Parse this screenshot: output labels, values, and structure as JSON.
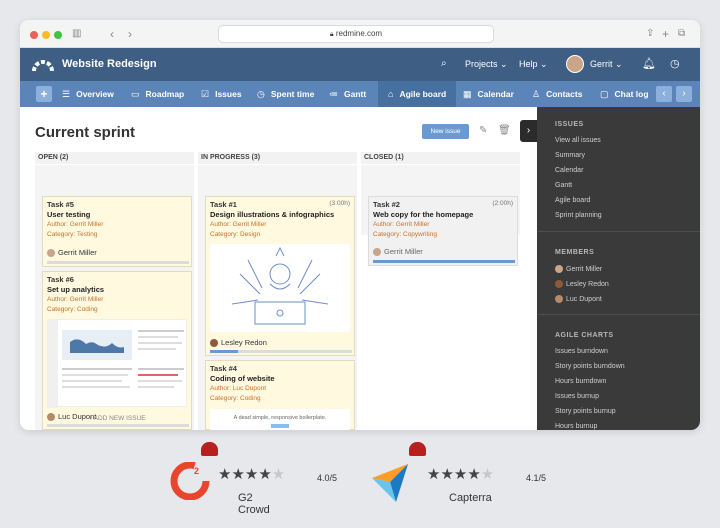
{
  "browser": {
    "url": "redmine.com",
    "icons": {
      "back": "chevron-left-icon",
      "forward": "chevron-right-icon",
      "sidebar": "sidebar-icon",
      "lock": "lock-icon",
      "share": "share-icon",
      "new_tab": "plus-icon",
      "tabs": "tabs-icon"
    }
  },
  "header": {
    "project_name": "Website Redesign",
    "projects_label": "Projects",
    "help_label": "Help",
    "user_name": "Gerrit"
  },
  "nav": {
    "items": [
      "Overview",
      "Roadmap",
      "Issues",
      "Spent time",
      "Gantt",
      "Agile board",
      "Calendar",
      "Contacts",
      "Chat log"
    ],
    "active": "Agile board"
  },
  "board": {
    "title": "Current sprint",
    "new_issue_label": "New issue",
    "columns": [
      "OPEN (2)",
      "IN PROGRESS (3)",
      "CLOSED (1)"
    ],
    "cards": [
      {
        "id": "Task #5",
        "subject": "User testing",
        "author": "Gerrit Miller",
        "category": "Testing",
        "assignee": "Gerrit Miller"
      },
      {
        "id": "Task #6",
        "subject": "Set up analytics",
        "author": "Gerrit Miller",
        "category": "Coding",
        "assignee": "Luc Dupont"
      },
      {
        "id": "Task #1",
        "hours": "(3:00h)",
        "subject": "Design illustrations & infographics",
        "author": "Gerrit Miller",
        "category": "Design",
        "assignee": "Lesley Redon"
      },
      {
        "id": "Task #4",
        "subject": "Coding of website",
        "author": "Luc Dupont",
        "category": "Coding",
        "preview_text": "A dead simple, responsive boilerplate."
      },
      {
        "id": "Task #2",
        "hours": "(2:00h)",
        "subject": "Web copy for the homepage",
        "author": "Gerrit Miller",
        "category": "Copywriting",
        "assignee": "Gerrit Miller",
        "progress": 1.0
      }
    ],
    "add_issue_label": "+ ADD NEW ISSUE",
    "author_label": "Author:",
    "category_label": "Category:"
  },
  "sidebar": {
    "issues_heading": "ISSUES",
    "issues_links": [
      "View all issues",
      "Summary",
      "Calendar",
      "Gantt",
      "Agile board",
      "Sprint planning"
    ],
    "members_heading": "MEMBERS",
    "members": [
      "Gerrit Miller",
      "Lesley Redon",
      "Luc Dupont"
    ],
    "charts_heading": "AGILE CHARTS",
    "charts_links": [
      "Issues burndown",
      "Story points burndown",
      "Hours burndown",
      "Issues burnup",
      "Story points burnup",
      "Hours burnup"
    ]
  },
  "ratings": [
    {
      "name": "G2 Crowd",
      "value": "4.0/5",
      "stars": 4,
      "logo": "g2-logo"
    },
    {
      "name": "Capterra",
      "value": "4.1/5",
      "stars": 4,
      "logo": "capterra-logo"
    }
  ],
  "colors": {
    "topbar": "#3e5e84",
    "nav": "#5b84b8",
    "sidebar": "#3a3a3a",
    "card": "#fff9e0",
    "accent": "#6b9ad0"
  }
}
